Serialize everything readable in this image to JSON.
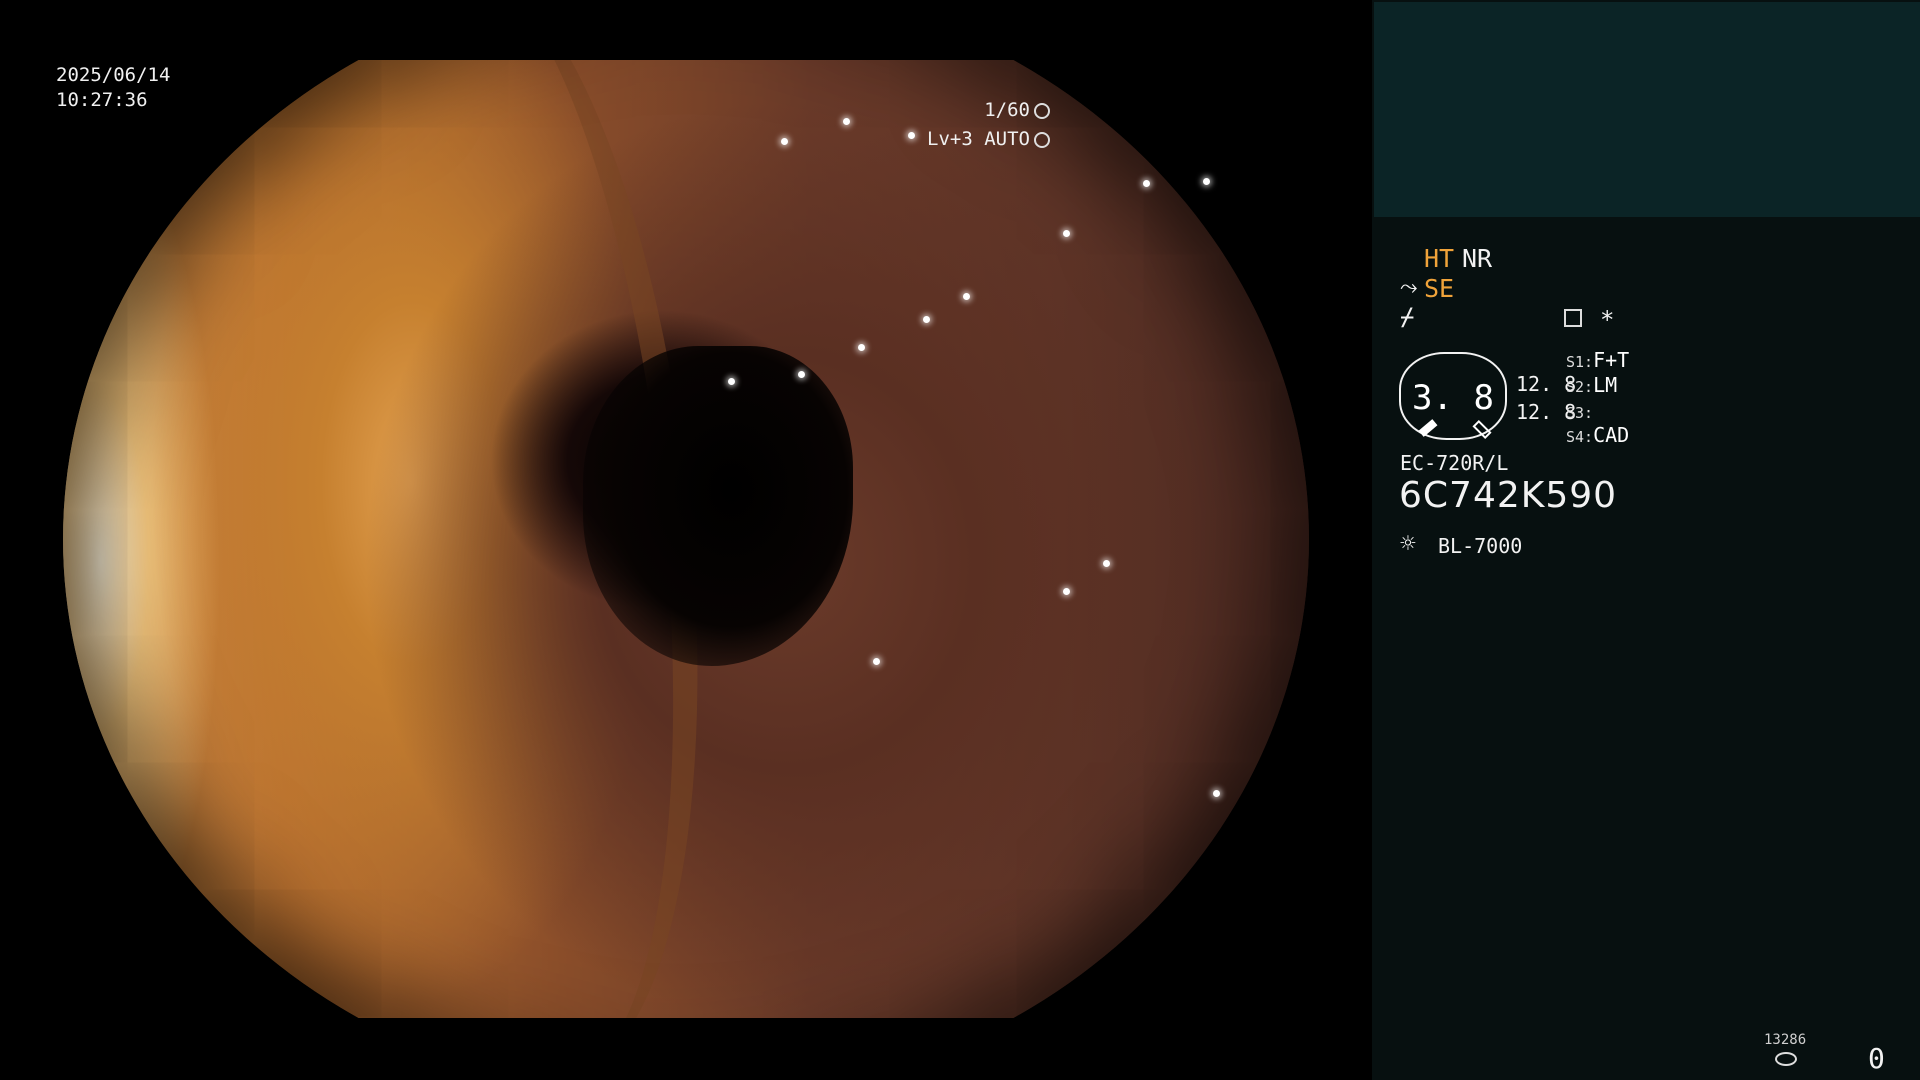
{
  "overlay": {
    "date": "2025/06/14",
    "time": "10:27:36",
    "shutter": "1/60",
    "shutter_icon": "shutter-icon",
    "exposure": "Lv+3 AUTO",
    "exposure_icon": "iris-icon"
  },
  "panel": {
    "ht": "HT",
    "nr": "NR",
    "se": "SE",
    "se_icon": "scope-icon",
    "mode_icon": "slash-icon",
    "memo_icon": "memo-icon",
    "asterisk": "*",
    "gauge_value": "3. 8",
    "readouts": [
      "12. 8",
      "12. 8"
    ],
    "switches": [
      {
        "label": "S1:",
        "value": "F+T"
      },
      {
        "label": "S2:",
        "value": "LM"
      },
      {
        "label": "S3:",
        "value": ""
      },
      {
        "label": "S4:",
        "value": "CAD"
      }
    ],
    "model": "EC-720R/L",
    "serial": "6C742K590",
    "light_icon": "light-source-icon",
    "light_source": "BL-7000",
    "storage_icon": "storage-icon",
    "storage_count": "13286",
    "counter": "0",
    "accent_color": "#f0a33a",
    "panel_top_color": "#0b2426"
  }
}
